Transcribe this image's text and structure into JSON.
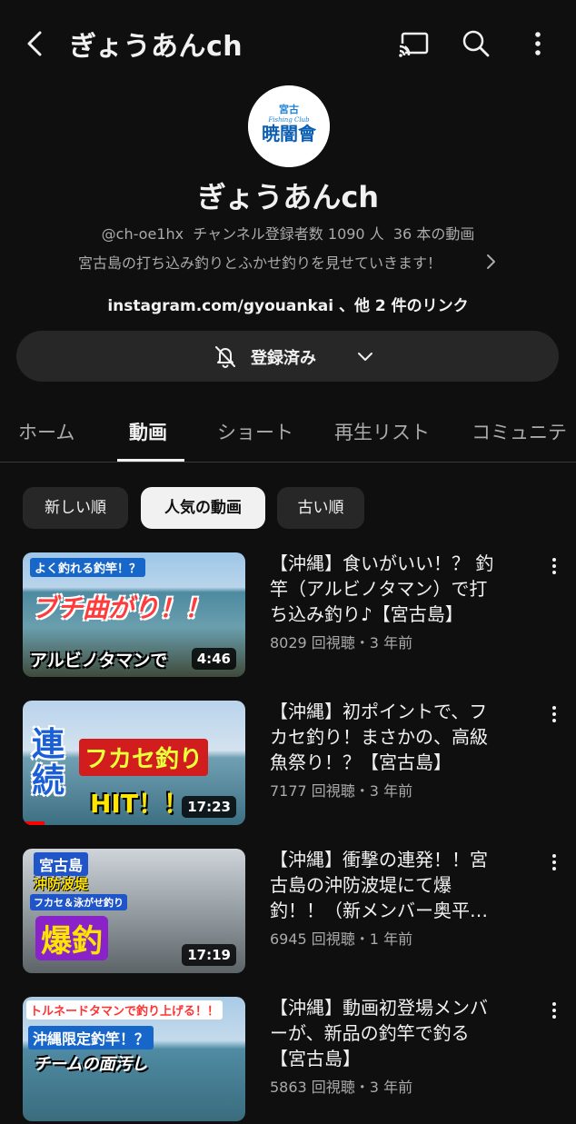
{
  "header": {
    "title": "ぎょうあんch"
  },
  "channel": {
    "name": "ぎょうあんch",
    "logo_small": "宮古",
    "logo_sub": "Fishing Club",
    "logo_main": "暁闇會",
    "handle": "@ch-oe1hx",
    "subscribers": "チャンネル登録者数 1090 人",
    "videos": "36 本の動画",
    "description": "宮古島の打ち込み釣りとふかせ釣りを見せていきます！",
    "link_main": "instagram.com/gyouankai",
    "link_suffix": "、他 2 件のリンク",
    "subscribe_label": "登録済み"
  },
  "tabs": [
    "ホーム",
    "動画",
    "ショート",
    "再生リスト",
    "コミュニテ"
  ],
  "chips": [
    "新しい順",
    "人気の動画",
    "古い順"
  ],
  "videos": [
    {
      "title_lines": [
        "【沖縄】食いがいい！？ 釣",
        "竿（アルビノタマン）で打",
        "ち込み釣り♪【宮古島】"
      ],
      "meta": "8029 回視聴・3 年前",
      "duration": "4:46",
      "overlay": [
        "よく釣れる釣竿！？",
        "ブチ曲がり！！",
        "アルビノタマンで"
      ],
      "progress": 0.0
    },
    {
      "title_lines": [
        "【沖縄】初ポイントで、フ",
        "カセ釣り！まさかの、高級",
        "魚祭り！？【宮古島】"
      ],
      "meta": "7177 回視聴・3 年前",
      "duration": "17:23",
      "overlay": [
        "連",
        "続",
        "フカセ釣り",
        "HIT！！"
      ],
      "progress": 0.1
    },
    {
      "title_lines": [
        "【沖縄】衝撃の連発！！宮",
        "古島の沖防波堤にて爆",
        "釣！！（新メンバー奥平…"
      ],
      "meta": "6945 回視聴・1 年前",
      "duration": "17:19",
      "overlay": [
        "宮古島",
        "沖防波堤",
        "フカセ＆泳がせ釣り",
        "爆釣"
      ],
      "progress": 0.0
    },
    {
      "title_lines": [
        "【沖縄】動画初登場メンバ",
        "ーが、新品の釣竿で釣る",
        "【宮古島】"
      ],
      "meta": "5863 回視聴・3 年前",
      "duration": "",
      "overlay": [
        "トルネードタマンで釣り上げる！！",
        "沖縄限定釣竿！？",
        "チームの面汚し"
      ],
      "progress": 0.0
    }
  ]
}
